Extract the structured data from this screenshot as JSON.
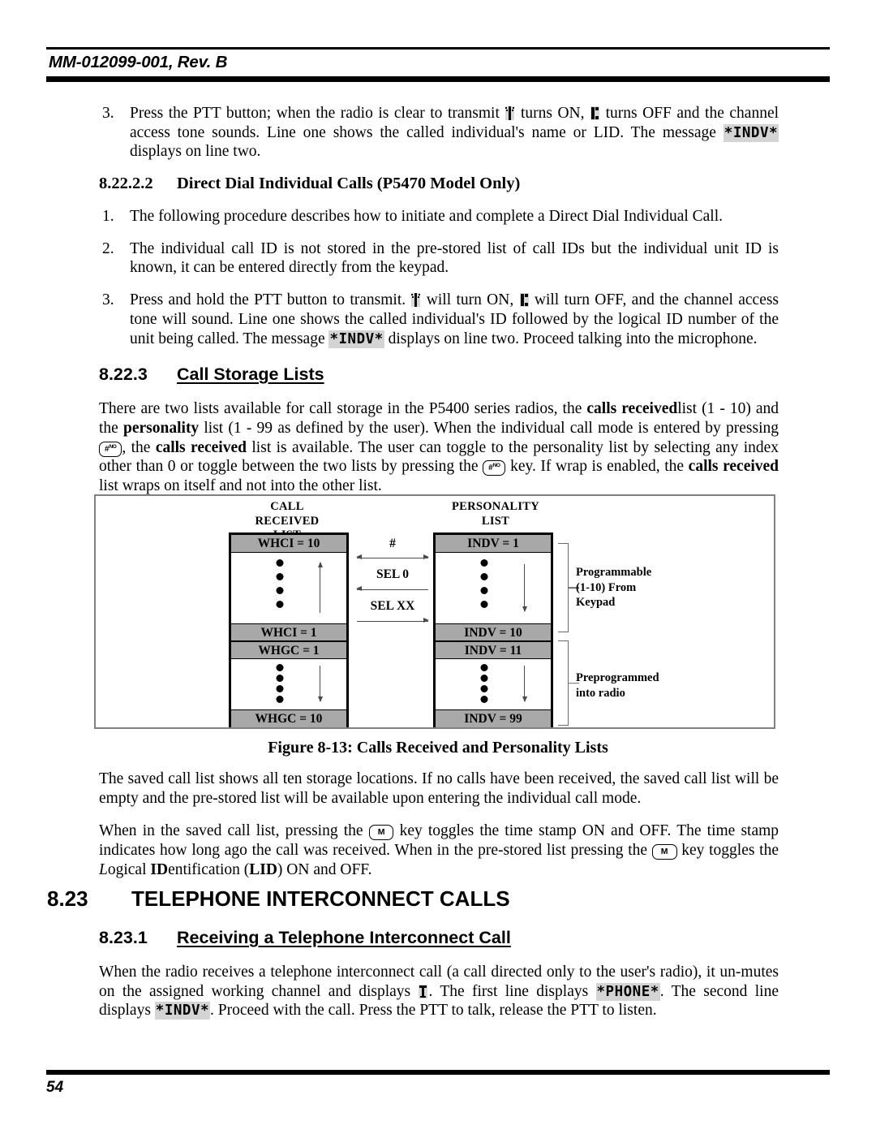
{
  "header": {
    "doc_id": "MM-012099-001, Rev. B"
  },
  "footer": {
    "page_number": "54"
  },
  "items": {
    "item3_a_pre": "Press the PTT button; when the radio is clear to transmit",
    "item3_a_mid": "turns ON,",
    "item3_a_mid2": "turns OFF and the channel access tone sounds. Line one shows the called individual's name or LID. The message",
    "item3_a_lcd": "*INDV*",
    "item3_a_end": "displays on line two.",
    "number_3": "3.",
    "number_1": "1.",
    "number_2": "2."
  },
  "section_8_22_2_2": {
    "number": "8.22.2.2",
    "title": "Direct Dial Individual Calls (P5470 Model Only)",
    "item1": "The following procedure describes how to initiate and complete a Direct Dial Individual Call.",
    "item2": "The individual call ID is not stored in the pre-stored list of call IDs but the individual unit ID is known, it can be entered directly from the keypad.",
    "item3_pre": "Press and hold the PTT button to transmit.",
    "item3_mid": "will turn ON,",
    "item3_mid2": "will turn OFF, and the channel access tone will sound. Line one shows the called individual's ID followed by the logical ID number of the unit being called. The message",
    "item3_lcd": "*INDV*",
    "item3_end": "displays on line two. Proceed talking into the microphone."
  },
  "section_8_22_3": {
    "number": "8.22.3",
    "title": "Call Storage Lists",
    "para_1": "There are two lists available for call storage in the P5400 series radios, the",
    "para_2": "calls received",
    "para_3": "list (1 - 10) and the",
    "para_4": "personality",
    "para_5": "list (1 - 99 as defined by the user). When the individual call mode is entered by pressing",
    "para_6": ", the",
    "para_7": "calls received",
    "para_8": "list is available. The user can toggle to the personality list by selecting any index other than 0 or toggle between the two lists by pressing the",
    "para_9": "key. If wrap is enabled, the",
    "para_10": "calls received",
    "para_11": "list wraps on itself and not into the other list."
  },
  "figure": {
    "caption": "Figure 8-13: Calls Received and Personality Lists",
    "left_list_title": "CALL\nRECEIVED\nLIST",
    "left_title_line1": "CALL",
    "left_title_line2": "RECEIVED",
    "left_title_line3": "LIST",
    "right_title_line1": "PERSONALITY",
    "right_title_line2": "LIST",
    "left_cells": {
      "top": "WHCI = 10",
      "mid_upper": "WHCI = 1",
      "mid_lower": "WHGC = 1",
      "bottom": "WHGC = 10"
    },
    "right_cells": {
      "top": "INDV = 1",
      "mid_upper": "INDV = 10",
      "mid_lower": "INDV = 11",
      "bottom": "INDV = 99"
    },
    "arrows": {
      "hash": "#",
      "sel0": "SEL 0",
      "selxx": "SEL XX"
    },
    "notes": {
      "programmable_l1": "Programmable",
      "programmable_l2": "(1-10) From",
      "programmable_l3": "Keypad",
      "preprogrammed_l1": "Preprogrammed",
      "preprogrammed_l2": "into radio"
    }
  },
  "after_figure": {
    "para1": "The saved call list shows all ten storage locations. If no calls have been received, the saved call list will be empty and the pre-stored list will be available upon entering the individual call mode.",
    "para2_a": "When in the saved call list, pressing the",
    "para2_b": "key toggles the time stamp ON and OFF. The time stamp indicates how long ago the call was received. When in the pre-stored list pressing the",
    "para2_c": "key toggles the",
    "para2_d": "L",
    "para2_e": "ogical ",
    "para2_f": "ID",
    "para2_g": "entification (",
    "para2_h": "LID",
    "para2_i": ") ON and OFF."
  },
  "section_8_23": {
    "number": "8.23",
    "title": "TELEPHONE INTERCONNECT CALLS"
  },
  "section_8_23_1": {
    "number": "8.23.1",
    "title": "Receiving a Telephone Interconnect Call",
    "para_a": "When the radio receives a telephone interconnect call (a call directed only to the user's radio), it un-mutes on the assigned working channel and displays",
    "para_b": ". The first line displays",
    "para_lcd_phone": "*PHONE*",
    "para_c": ". The second line displays",
    "para_lcd_indv": "*INDV*",
    "para_d": ". Proceed with the call. Press the PTT to talk, release the PTT to listen."
  },
  "keys": {
    "hash_no": "#",
    "hash_no_sup": "NO",
    "m_key": "M"
  }
}
